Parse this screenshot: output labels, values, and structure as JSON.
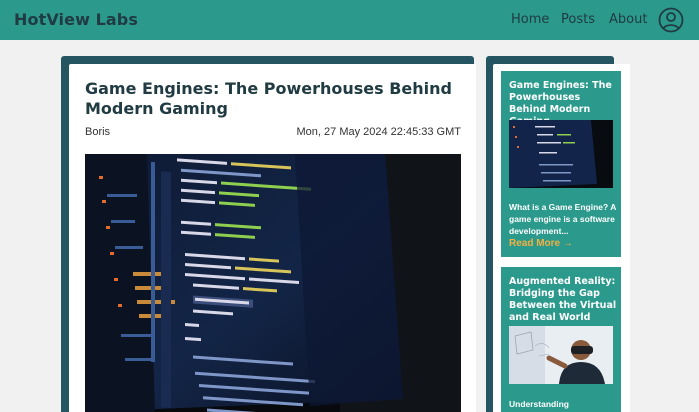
{
  "header": {
    "brand": "HotView Labs",
    "nav": [
      "Home",
      "Posts",
      "About"
    ],
    "user_icon": "user-circle-icon"
  },
  "article": {
    "title": "Game Engines: The Powerhouses Behind Modern Gaming",
    "author": "Boris",
    "date": "Mon, 27 May 2024 22:45:33 GMT",
    "image": "laptop-code-editor-photo"
  },
  "sidebar": {
    "posts": [
      {
        "title": "Game Engines: The Powerhouses Behind Modern Gaming",
        "excerpt": "What is a Game Engine? A game engine is a software development...",
        "more": "Read More →",
        "image": "laptop-code-editor-photo"
      },
      {
        "title": "Augmented Reality: Bridging the Gap Between the Virtual and Real World",
        "excerpt": "Understanding Augmented Reality",
        "image": "person-with-vr-headset-photo"
      }
    ]
  },
  "colors": {
    "header": "#2b9a8c",
    "card_frame": "#255560",
    "text_dark": "#203b42",
    "accent": "#f4b042"
  }
}
